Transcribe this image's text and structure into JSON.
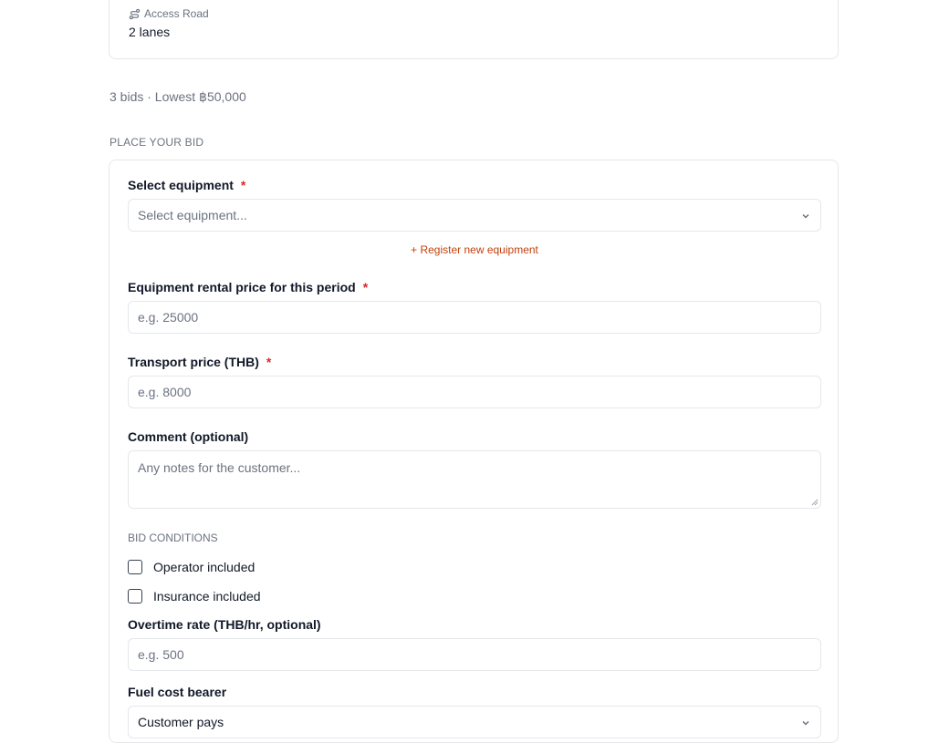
{
  "spec": {
    "label": "Access Road",
    "value": "2 lanes",
    "icon": "route-icon"
  },
  "summary": "3 bids · Lowest ฿50,000",
  "section_title": "PLACE YOUR BID",
  "form": {
    "equipment": {
      "label": "Select equipment",
      "required_mark": "*",
      "placeholder": "Select equipment..."
    },
    "register_link": "+ Register new equipment",
    "rental_price": {
      "label": "Equipment rental price for this period",
      "required_mark": "*",
      "placeholder": "e.g. 25000"
    },
    "transport_price": {
      "label": "Transport price (THB)",
      "required_mark": "*",
      "placeholder": "e.g. 8000"
    },
    "comment": {
      "label": "Comment (optional)",
      "placeholder": "Any notes for the customer..."
    },
    "conditions_title": "BID CONDITIONS",
    "operator_included": {
      "label": "Operator included",
      "checked": false
    },
    "insurance_included": {
      "label": "Insurance included",
      "checked": false
    },
    "overtime": {
      "label": "Overtime rate (THB/hr, optional)",
      "placeholder": "e.g. 500"
    },
    "fuel": {
      "label": "Fuel cost bearer",
      "value": "Customer pays"
    }
  },
  "colors": {
    "accent": "#c2410c",
    "required": "#dc2626",
    "border": "#e5e7eb",
    "muted": "#6b7280"
  }
}
